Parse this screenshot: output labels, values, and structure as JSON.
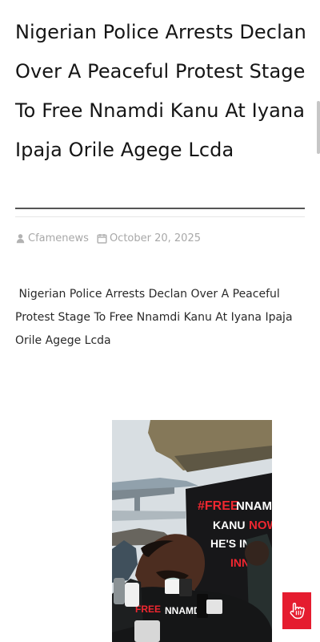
{
  "article": {
    "title": "Nigerian Police Arrests Declan Over A Peaceful Protest Stage To Free Nnamdi Kanu At Iyana Ipaja Orile Agege Lcda",
    "author": "Cfamenews",
    "date": "October 20, 2025",
    "body": "Nigerian Police Arrests Declan Over A Peaceful Protest Stage To Free Nnamdi Kanu At Iyana Ipaja Orile Agege Lcda",
    "image_alt": "Protester speaking to reporters",
    "poster_text": "#FREE NNAMDI KANU NOW HE'S INNOCENT"
  },
  "icons": {
    "author": "user-icon",
    "date": "calendar-icon",
    "action": "hand-pointer-icon"
  },
  "colors": {
    "action": "#e51c2f",
    "meta": "#a8a8a8",
    "rule": "#555555"
  }
}
